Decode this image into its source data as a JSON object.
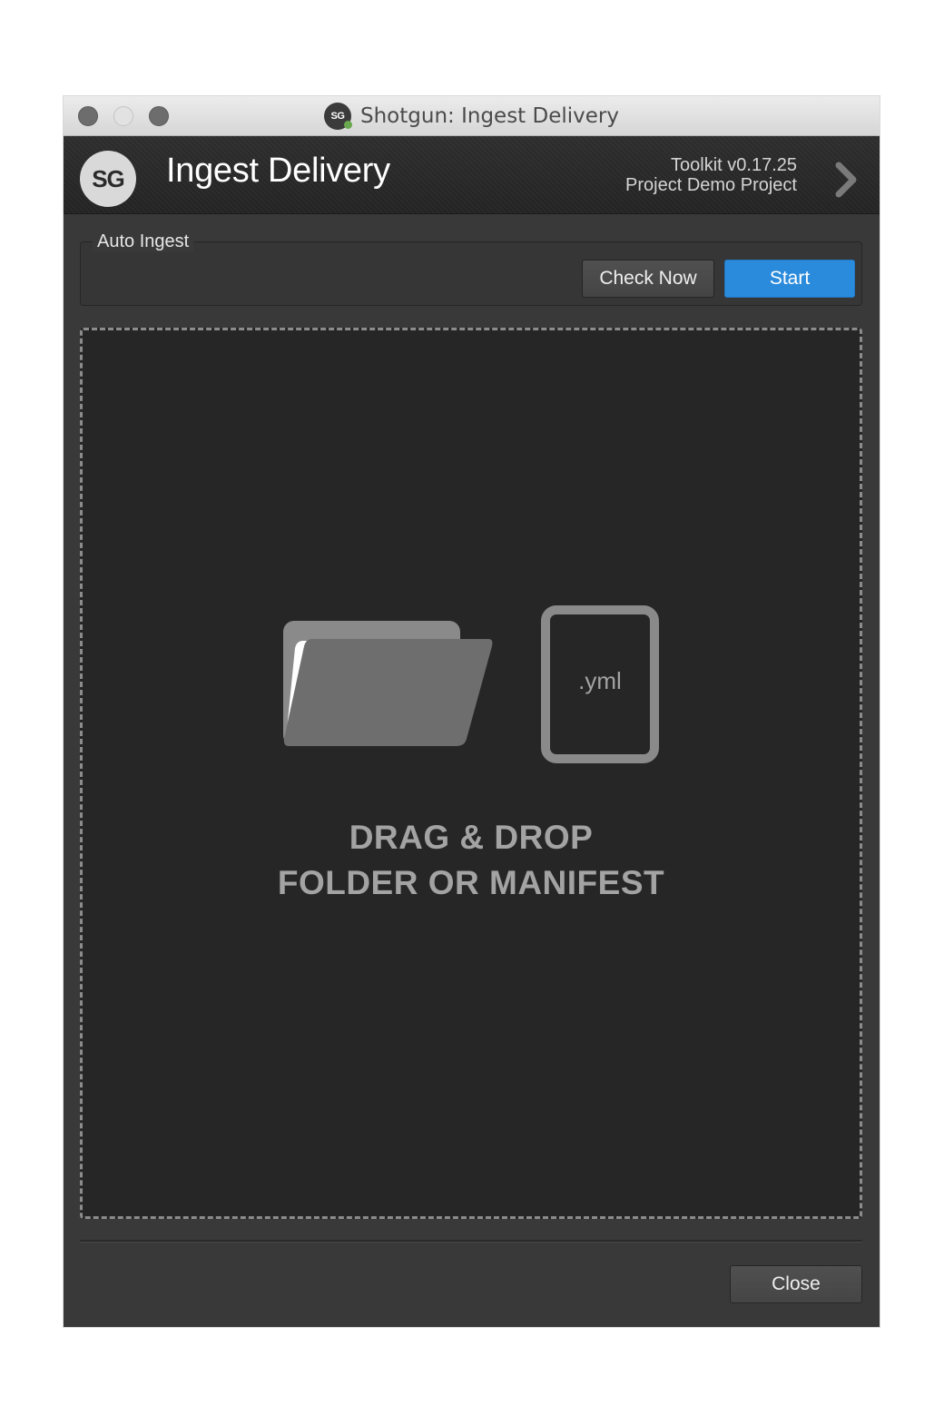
{
  "window": {
    "title": "Shotgun: Ingest Delivery",
    "title_icon": "shotgun-logo-icon"
  },
  "header": {
    "logo_text": "SG",
    "app_title": "Ingest Delivery",
    "toolkit_version": "Toolkit v0.17.25",
    "project": "Project Demo Project",
    "chevron_icon": "chevron-right-icon"
  },
  "auto_ingest": {
    "group_label": "Auto Ingest",
    "check_now_label": "Check Now",
    "start_label": "Start"
  },
  "dropzone": {
    "folder_icon": "folder-icon",
    "manifest_icon": "manifest-file-icon",
    "manifest_ext": ".yml",
    "line1": "DRAG & DROP",
    "line2": "FOLDER OR MANIFEST"
  },
  "footer": {
    "close_label": "Close"
  },
  "colors": {
    "accent": "#2a8bdc",
    "window_bg": "#393939",
    "dropzone_bg": "#262626",
    "dropzone_border": "#8c8c8c",
    "drop_text": "#a3a3a3"
  }
}
